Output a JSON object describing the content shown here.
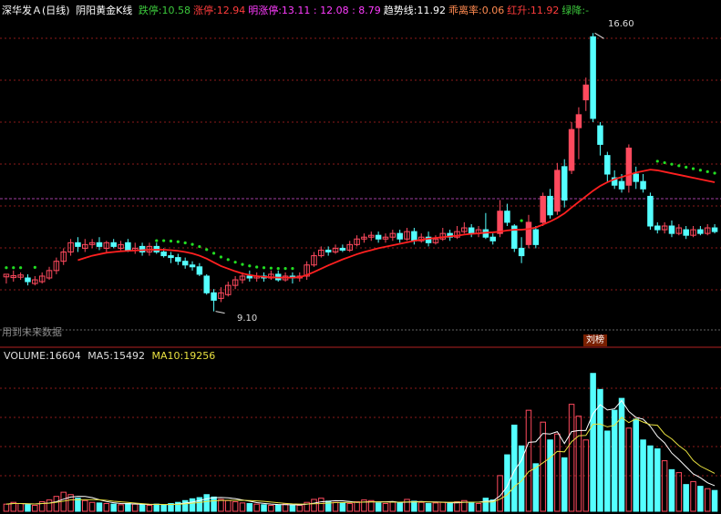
{
  "header": {
    "stock": "深华发Ａ(日线)",
    "indicator": "阴阳黄金K线",
    "items": [
      {
        "label": "跌停:",
        "value": "10.58",
        "color": "#3cc83c"
      },
      {
        "label": "涨停:",
        "value": "12.94",
        "color": "#ff3c3c"
      },
      {
        "label": "明涨停:",
        "value": "13.11 : 12.08 : 8.79",
        "color": "#ff3cff"
      },
      {
        "label": "趋势线:",
        "value": "11.92",
        "color": "#ffffff"
      },
      {
        "label": "乖离率:",
        "value": "0.06",
        "color": "#ff8a50"
      },
      {
        "label": "红升:",
        "value": "11.92",
        "color": "#ff3c3c"
      },
      {
        "label": "绿降:",
        "value": "-",
        "color": "#3cc83c"
      }
    ]
  },
  "annotations": {
    "high_label": "16.60",
    "low_label": "9.10",
    "future_data_note": "用到未来数据",
    "tag": "刘榜"
  },
  "volume_header": {
    "volume_label": "VOLUME:",
    "volume_value": "16604",
    "ma5_label": "MA5:",
    "ma5_value": "15492",
    "ma10_label": "MA10:",
    "ma10_value": "19256"
  },
  "colors": {
    "up": "#ff4a5e",
    "down": "#54ffff",
    "trend": "#ff2020",
    "dots": "#22dd22",
    "ma5": "#ffffff",
    "ma10": "#e8e040",
    "grid": "#8b1a1a"
  },
  "chart_data": {
    "type": "candlestick",
    "price_range": [
      8.6,
      17.0
    ],
    "candles": [
      [
        10.03,
        10.1,
        10.08,
        9.85
      ],
      [
        10.01,
        10.06,
        10.2,
        9.9
      ],
      [
        10.02,
        10.08,
        10.15,
        9.95
      ],
      [
        10.0,
        9.9,
        10.1,
        9.8
      ],
      [
        9.85,
        9.95,
        10.05,
        9.8
      ],
      [
        9.9,
        10.05,
        10.15,
        9.85
      ],
      [
        10.0,
        10.2,
        10.3,
        9.95
      ],
      [
        10.2,
        10.45,
        10.55,
        10.1
      ],
      [
        10.45,
        10.7,
        10.8,
        10.35
      ],
      [
        10.7,
        10.95,
        11.05,
        10.6
      ],
      [
        10.95,
        10.85,
        11.1,
        10.7
      ],
      [
        10.8,
        10.9,
        11.05,
        10.7
      ],
      [
        10.9,
        10.95,
        11.05,
        10.8
      ],
      [
        10.95,
        10.85,
        11.1,
        10.75
      ],
      [
        10.8,
        10.95,
        11.0,
        10.7
      ],
      [
        10.95,
        10.85,
        11.05,
        10.8
      ],
      [
        10.8,
        10.9,
        11.0,
        10.75
      ],
      [
        10.95,
        10.75,
        11.05,
        10.7
      ],
      [
        10.75,
        10.8,
        10.95,
        10.65
      ],
      [
        10.85,
        10.7,
        10.95,
        10.6
      ],
      [
        10.7,
        10.85,
        10.95,
        10.6
      ],
      [
        10.85,
        10.7,
        10.95,
        10.65
      ],
      [
        10.7,
        10.6,
        10.8,
        10.55
      ],
      [
        10.6,
        10.55,
        10.7,
        10.4
      ],
      [
        10.55,
        10.45,
        10.65,
        10.35
      ],
      [
        10.45,
        10.35,
        10.55,
        10.25
      ],
      [
        10.35,
        10.3,
        10.45,
        10.2
      ],
      [
        10.3,
        10.1,
        10.4,
        10.05
      ],
      [
        10.05,
        9.6,
        10.1,
        9.55
      ],
      [
        9.6,
        9.4,
        9.7,
        9.1
      ],
      [
        9.45,
        9.6,
        9.75,
        9.35
      ],
      [
        9.55,
        9.8,
        9.9,
        9.5
      ],
      [
        9.8,
        9.95,
        10.05,
        9.7
      ],
      [
        9.95,
        10.05,
        10.15,
        9.85
      ],
      [
        10.05,
        10.0,
        10.2,
        9.9
      ],
      [
        10.0,
        10.05,
        10.15,
        9.9
      ],
      [
        10.05,
        10.0,
        10.15,
        9.9
      ],
      [
        10.0,
        10.1,
        10.2,
        9.95
      ],
      [
        10.1,
        9.95,
        10.2,
        9.9
      ],
      [
        9.95,
        10.05,
        10.15,
        9.9
      ],
      [
        10.05,
        10.0,
        10.15,
        9.85
      ],
      [
        10.0,
        10.05,
        10.15,
        9.9
      ],
      [
        10.05,
        10.35,
        10.45,
        9.95
      ],
      [
        10.35,
        10.6,
        10.7,
        10.3
      ],
      [
        10.6,
        10.75,
        10.85,
        10.55
      ],
      [
        10.75,
        10.7,
        10.85,
        10.6
      ],
      [
        10.7,
        10.8,
        10.9,
        10.65
      ],
      [
        10.8,
        10.75,
        10.9,
        10.7
      ],
      [
        10.75,
        10.9,
        11.0,
        10.7
      ],
      [
        10.9,
        11.05,
        11.15,
        10.85
      ],
      [
        11.05,
        11.1,
        11.2,
        10.95
      ],
      [
        11.1,
        11.15,
        11.25,
        11.0
      ],
      [
        11.15,
        11.05,
        11.25,
        10.95
      ],
      [
        11.05,
        11.1,
        11.2,
        10.95
      ],
      [
        11.1,
        11.2,
        11.3,
        11.0
      ],
      [
        11.2,
        11.05,
        11.3,
        10.95
      ],
      [
        11.05,
        11.25,
        11.35,
        11.0
      ],
      [
        11.25,
        11.0,
        11.35,
        10.9
      ],
      [
        11.0,
        11.1,
        11.2,
        10.95
      ],
      [
        11.1,
        10.95,
        11.25,
        10.85
      ],
      [
        10.95,
        11.05,
        11.15,
        10.9
      ],
      [
        11.05,
        11.2,
        11.35,
        11.0
      ],
      [
        11.2,
        11.1,
        11.3,
        11.0
      ],
      [
        11.1,
        11.25,
        11.4,
        11.05
      ],
      [
        11.25,
        11.35,
        11.5,
        11.2
      ],
      [
        11.35,
        11.2,
        11.45,
        11.1
      ],
      [
        11.2,
        11.3,
        11.4,
        11.1
      ],
      [
        11.3,
        11.1,
        11.75,
        11.05
      ],
      [
        11.1,
        11.0,
        11.2,
        10.9
      ],
      [
        11.2,
        11.8,
        12.1,
        11.1
      ],
      [
        11.8,
        11.5,
        12.0,
        11.4
      ],
      [
        11.4,
        10.8,
        11.45,
        10.7
      ],
      [
        10.8,
        10.6,
        11.1,
        10.4
      ],
      [
        10.9,
        11.5,
        11.7,
        10.8
      ],
      [
        11.3,
        10.9,
        11.4,
        10.8
      ],
      [
        11.5,
        12.2,
        12.3,
        11.4
      ],
      [
        12.2,
        11.7,
        12.4,
        11.6
      ],
      [
        11.8,
        12.9,
        13.1,
        11.7
      ],
      [
        13.0,
        12.1,
        13.2,
        11.9
      ],
      [
        12.9,
        14.0,
        14.2,
        12.8
      ],
      [
        14.05,
        14.4,
        14.6,
        13.2
      ],
      [
        14.8,
        15.2,
        15.4,
        14.5
      ],
      [
        16.5,
        14.3,
        16.6,
        14.2
      ],
      [
        14.1,
        13.6,
        14.2,
        13.3
      ],
      [
        13.3,
        12.8,
        13.4,
        12.6
      ],
      [
        12.7,
        12.5,
        12.9,
        12.4
      ],
      [
        12.6,
        12.4,
        12.8,
        12.3
      ],
      [
        12.5,
        13.5,
        13.6,
        12.3
      ],
      [
        12.8,
        12.6,
        13.0,
        12.4
      ],
      [
        12.6,
        12.4,
        12.8,
        12.3
      ],
      [
        12.2,
        11.4,
        12.3,
        11.3
      ],
      [
        11.4,
        11.3,
        11.5,
        11.2
      ],
      [
        11.3,
        11.4,
        11.5,
        11.2
      ],
      [
        11.4,
        11.2,
        11.55,
        11.1
      ],
      [
        11.2,
        11.35,
        11.45,
        11.15
      ],
      [
        11.3,
        11.15,
        11.4,
        11.05
      ],
      [
        11.15,
        11.3,
        11.4,
        11.1
      ],
      [
        11.3,
        11.2,
        11.4,
        11.15
      ],
      [
        11.2,
        11.35,
        11.45,
        11.15
      ],
      [
        11.35,
        11.25,
        11.45,
        11.2
      ]
    ],
    "trend_line": [
      10.03,
      10.03,
      10.03,
      10.04,
      10.04,
      10.05,
      10.1,
      10.2,
      10.3,
      10.4,
      10.48,
      10.54,
      10.6,
      10.64,
      10.68,
      10.7,
      10.72,
      10.73,
      10.74,
      10.75,
      10.76,
      10.76,
      10.76,
      10.75,
      10.73,
      10.7,
      10.66,
      10.6,
      10.52,
      10.42,
      10.32,
      10.25,
      10.18,
      10.12,
      10.08,
      10.05,
      10.03,
      10.02,
      10.01,
      10.01,
      10.01,
      10.02,
      10.08,
      10.16,
      10.25,
      10.34,
      10.42,
      10.5,
      10.57,
      10.64,
      10.7,
      10.75,
      10.8,
      10.84,
      10.88,
      10.92,
      10.96,
      11.0,
      11.03,
      11.06,
      11.08,
      11.1,
      11.12,
      11.14,
      11.17,
      11.19,
      11.2,
      11.22,
      11.23,
      11.25,
      11.28,
      11.3,
      11.3,
      11.32,
      11.36,
      11.44,
      11.52,
      11.62,
      11.74,
      11.9,
      12.05,
      12.2,
      12.35,
      12.48,
      12.58,
      12.66,
      12.72,
      12.78,
      12.84,
      12.88,
      12.92,
      12.9,
      12.86,
      12.82,
      12.78,
      12.74,
      12.7,
      12.66,
      12.62,
      12.58
    ],
    "volume": {
      "range_max": 25000,
      "values": [
        1200,
        1500,
        1300,
        1100,
        1000,
        1600,
        1900,
        2500,
        3200,
        2800,
        2200,
        1800,
        1500,
        1400,
        1300,
        1200,
        1100,
        1300,
        1200,
        1100,
        1000,
        1200,
        1100,
        1300,
        1500,
        1800,
        2100,
        2300,
        2800,
        2400,
        2000,
        1800,
        1600,
        1400,
        1300,
        1200,
        1100,
        1000,
        1100,
        1200,
        1100,
        1000,
        1500,
        2000,
        2200,
        1700,
        1500,
        1400,
        1300,
        1600,
        1900,
        1800,
        1400,
        1300,
        1600,
        1400,
        2000,
        1700,
        1500,
        1300,
        1400,
        1500,
        1300,
        1600,
        1800,
        1500,
        1300,
        2200,
        1900,
        6000,
        9500,
        14500,
        11000,
        17000,
        8000,
        15000,
        12000,
        13000,
        9000,
        18000,
        16000,
        12000,
        23200,
        20500,
        13500,
        17000,
        19000,
        14000,
        15500,
        12000,
        11000,
        10500,
        8500,
        7000,
        6500,
        4500,
        5000,
        4200,
        3800,
        3500
      ],
      "up": [
        1,
        1,
        1,
        0,
        1,
        1,
        1,
        1,
        1,
        1,
        0,
        1,
        1,
        0,
        1,
        0,
        1,
        0,
        1,
        0,
        1,
        0,
        0,
        0,
        0,
        0,
        0,
        0,
        0,
        0,
        1,
        1,
        1,
        1,
        0,
        1,
        0,
        1,
        0,
        1,
        0,
        1,
        1,
        1,
        1,
        0,
        1,
        0,
        1,
        1,
        1,
        1,
        0,
        1,
        1,
        0,
        1,
        0,
        1,
        0,
        1,
        1,
        0,
        1,
        1,
        0,
        1,
        0,
        0,
        1,
        0,
        0,
        0,
        1,
        0,
        1,
        0,
        1,
        0,
        1,
        1,
        1,
        0,
        0,
        0,
        0,
        0,
        1,
        0,
        0,
        0,
        0,
        1,
        0,
        1,
        0,
        1,
        0,
        1,
        0
      ],
      "ma5": [
        1200,
        1300,
        1300,
        1250,
        1220,
        1300,
        1380,
        1620,
        2040,
        2400,
        2520,
        2500,
        2300,
        1940,
        1640,
        1440,
        1300,
        1260,
        1220,
        1180,
        1140,
        1160,
        1140,
        1140,
        1220,
        1380,
        1560,
        1800,
        2100,
        2280,
        2320,
        2260,
        2120,
        1900,
        1700,
        1460,
        1320,
        1200,
        1140,
        1120,
        1100,
        1080,
        1180,
        1360,
        1600,
        1680,
        1780,
        1760,
        1640,
        1500,
        1560,
        1600,
        1600,
        1600,
        1640,
        1500,
        1540,
        1600,
        1640,
        1580,
        1580,
        1540,
        1440,
        1420,
        1520,
        1540,
        1540,
        1680,
        1740,
        2580,
        4180,
        6820,
        8580,
        11600,
        11700,
        13100,
        13000,
        13400,
        11400,
        13400,
        13600,
        13600,
        16440,
        17940,
        17040,
        17240,
        18640,
        16800,
        15800,
        15500,
        14300,
        12600,
        11500,
        9800,
        8700,
        7500,
        6300,
        5640,
        4800,
        4300
      ],
      "ma10": [
        1200,
        1300,
        1300,
        1270,
        1220,
        1300,
        1370,
        1510,
        1700,
        1910,
        1930,
        1960,
        1960,
        1940,
        1850,
        1690,
        1590,
        1490,
        1380,
        1280,
        1190,
        1170,
        1150,
        1150,
        1170,
        1250,
        1370,
        1480,
        1650,
        1760,
        1820,
        1850,
        1850,
        1850,
        1800,
        1740,
        1670,
        1560,
        1430,
        1330,
        1250,
        1210,
        1220,
        1260,
        1300,
        1380,
        1450,
        1480,
        1500,
        1520,
        1560,
        1590,
        1580,
        1550,
        1540,
        1530,
        1570,
        1580,
        1600,
        1570,
        1530,
        1520,
        1520,
        1530,
        1520,
        1540,
        1530,
        1560,
        1580,
        2040,
        2770,
        4160,
        5100,
        6670,
        7310,
        8160,
        9010,
        10080,
        10000,
        11700,
        12710,
        12760,
        14640,
        14680,
        14200,
        14460,
        15810,
        14920,
        15560,
        15010,
        14570,
        14470,
        13000,
        12180,
        11040,
        10150,
        8550,
        7590,
        6990,
        6380
      ]
    }
  }
}
